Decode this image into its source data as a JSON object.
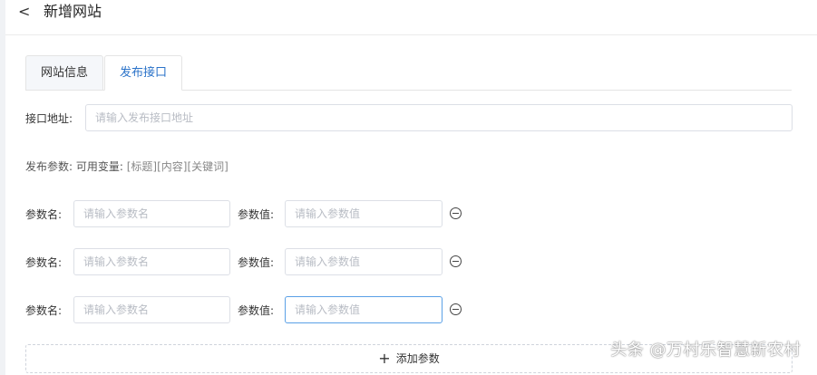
{
  "header": {
    "back_glyph": "<",
    "title": "新增网站"
  },
  "tabs": [
    {
      "label": "网站信息",
      "active": false
    },
    {
      "label": "发布接口",
      "active": true
    }
  ],
  "endpoint": {
    "label": "接口地址:",
    "value": "",
    "placeholder": "请输入发布接口地址"
  },
  "params_hint": {
    "label": "发布参数:",
    "prefix": "可用变量:",
    "variables": "[标题][内容][关键词]"
  },
  "param_rows": [
    {
      "name_label": "参数名:",
      "name_placeholder": "请输入参数名",
      "value_label": "参数值:",
      "value_placeholder": "请输入参数值"
    },
    {
      "name_label": "参数名:",
      "name_placeholder": "请输入参数名",
      "value_label": "参数值:",
      "value_placeholder": "请输入参数值"
    },
    {
      "name_label": "参数名:",
      "name_placeholder": "请输入参数名",
      "value_label": "参数值:",
      "value_placeholder": "请输入参数值"
    }
  ],
  "add_button": {
    "icon": "+",
    "label": "添加参数"
  },
  "watermark": "头条 @万村乐智慧新农村",
  "colors": {
    "accent": "#2b73c9",
    "focus_border": "#5aa0e6"
  }
}
